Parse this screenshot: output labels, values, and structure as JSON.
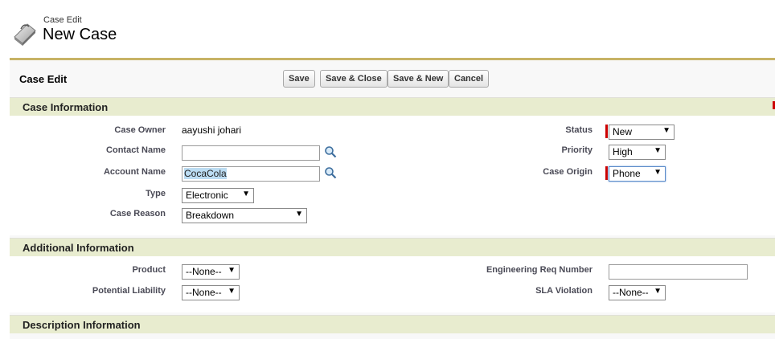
{
  "header": {
    "subtitle": "Case Edit",
    "title": "New Case"
  },
  "toolbar": {
    "title": "Case Edit",
    "save_label": "Save",
    "save_close_label": "Save & Close",
    "save_new_label": "Save & New",
    "cancel_label": "Cancel"
  },
  "sections": {
    "case_info": {
      "title": "Case Information",
      "case_owner_label": "Case Owner",
      "case_owner_value": "aayushi johari",
      "contact_name_label": "Contact Name",
      "contact_name_value": "",
      "account_name_label": "Account Name",
      "account_name_value": "CocaCola",
      "type_label": "Type",
      "type_value": "Electronic",
      "case_reason_label": "Case Reason",
      "case_reason_value": "Breakdown",
      "status_label": "Status",
      "status_value": "New",
      "priority_label": "Priority",
      "priority_value": "High",
      "case_origin_label": "Case Origin",
      "case_origin_value": "Phone"
    },
    "additional_info": {
      "title": "Additional Information",
      "product_label": "Product",
      "product_value": "--None--",
      "potential_liability_label": "Potential Liability",
      "potential_liability_value": "--None--",
      "eng_req_label": "Engineering Req Number",
      "eng_req_value": "",
      "sla_violation_label": "SLA Violation",
      "sla_violation_value": "--None--"
    },
    "description_info": {
      "title": "Description Information"
    }
  },
  "icons": {
    "dropdown": "▼"
  },
  "colors": {
    "accent_border": "#c7b365",
    "section_bg": "#e8eccf",
    "required": "#cc0000"
  }
}
